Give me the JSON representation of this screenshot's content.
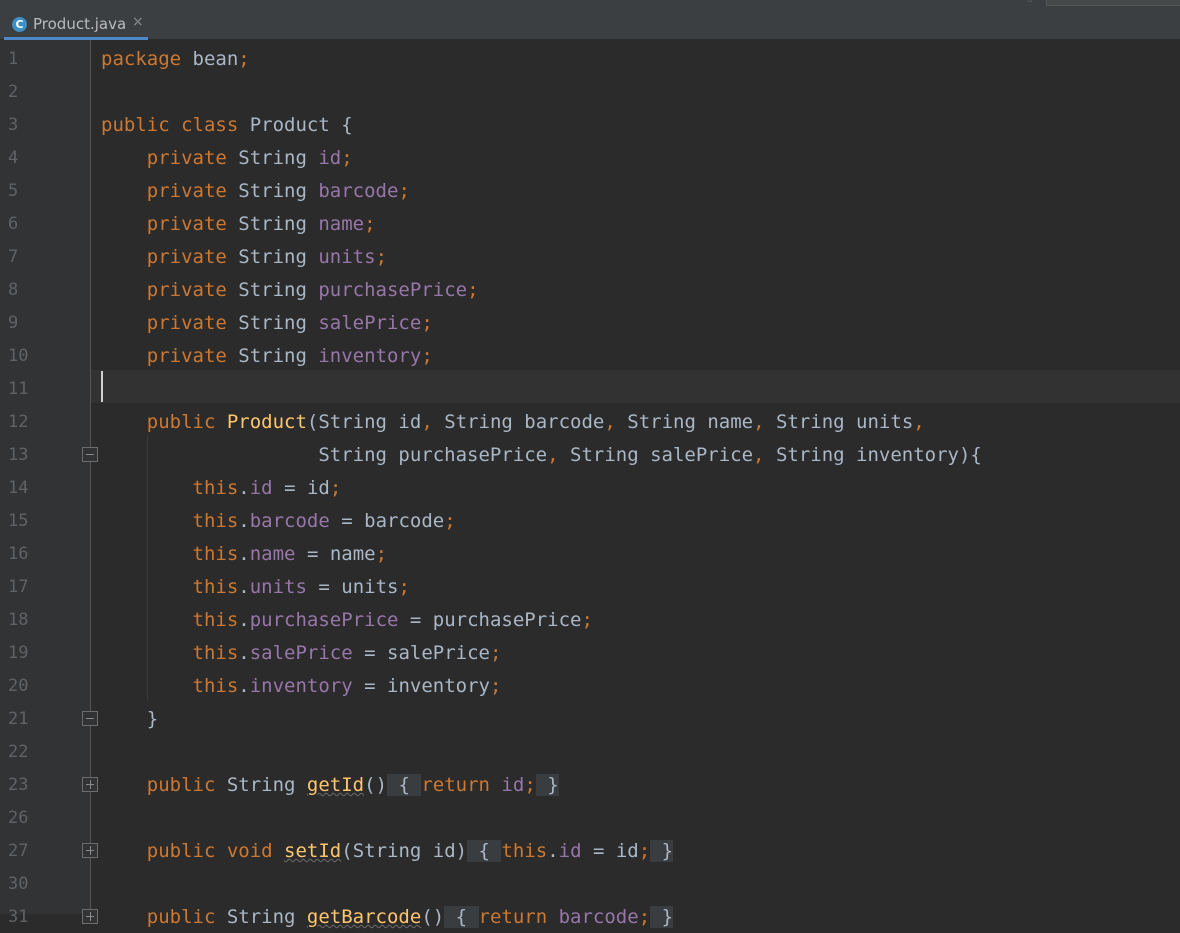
{
  "tab": {
    "label": "Product.java",
    "icon_letter": "C",
    "close": "×"
  },
  "lines": [
    {
      "num": "1",
      "parts": [
        [
          "kw",
          "package "
        ],
        [
          "pl",
          "bean"
        ],
        [
          "punct",
          ";"
        ]
      ]
    },
    {
      "num": "2",
      "parts": []
    },
    {
      "num": "3",
      "parts": [
        [
          "kw",
          "public class "
        ],
        [
          "pl",
          "Product {"
        ]
      ]
    },
    {
      "num": "4",
      "parts": [
        [
          "pl",
          "    "
        ],
        [
          "kw",
          "private "
        ],
        [
          "pl",
          "String "
        ],
        [
          "fld",
          "id"
        ],
        [
          "punct",
          ";"
        ]
      ]
    },
    {
      "num": "5",
      "parts": [
        [
          "pl",
          "    "
        ],
        [
          "kw",
          "private "
        ],
        [
          "pl",
          "String "
        ],
        [
          "fld",
          "barcode"
        ],
        [
          "punct",
          ";"
        ]
      ]
    },
    {
      "num": "6",
      "parts": [
        [
          "pl",
          "    "
        ],
        [
          "kw",
          "private "
        ],
        [
          "pl",
          "String "
        ],
        [
          "fld",
          "name"
        ],
        [
          "punct",
          ";"
        ]
      ]
    },
    {
      "num": "7",
      "parts": [
        [
          "pl",
          "    "
        ],
        [
          "kw",
          "private "
        ],
        [
          "pl",
          "String "
        ],
        [
          "fld",
          "units"
        ],
        [
          "punct",
          ";"
        ]
      ]
    },
    {
      "num": "8",
      "parts": [
        [
          "pl",
          "    "
        ],
        [
          "kw",
          "private "
        ],
        [
          "pl",
          "String "
        ],
        [
          "fld",
          "purchasePrice"
        ],
        [
          "punct",
          ";"
        ]
      ]
    },
    {
      "num": "9",
      "parts": [
        [
          "pl",
          "    "
        ],
        [
          "kw",
          "private "
        ],
        [
          "pl",
          "String "
        ],
        [
          "fld",
          "salePrice"
        ],
        [
          "punct",
          ";"
        ]
      ]
    },
    {
      "num": "10",
      "parts": [
        [
          "pl",
          "    "
        ],
        [
          "kw",
          "private "
        ],
        [
          "pl",
          "String "
        ],
        [
          "fld",
          "inventory"
        ],
        [
          "punct",
          ";"
        ]
      ]
    },
    {
      "num": "11",
      "parts": []
    },
    {
      "num": "12",
      "parts": [
        [
          "pl",
          "    "
        ],
        [
          "kw",
          "public "
        ],
        [
          "fn",
          "Product"
        ],
        [
          "pl",
          "(String id"
        ],
        [
          "punct",
          ", "
        ],
        [
          "pl",
          "String barcode"
        ],
        [
          "punct",
          ", "
        ],
        [
          "pl",
          "String name"
        ],
        [
          "punct",
          ", "
        ],
        [
          "pl",
          "String units"
        ],
        [
          "punct",
          ","
        ]
      ]
    },
    {
      "num": "13",
      "parts": [
        [
          "pl",
          "                   String purchasePrice"
        ],
        [
          "punct",
          ", "
        ],
        [
          "pl",
          "String salePrice"
        ],
        [
          "punct",
          ", "
        ],
        [
          "pl",
          "String inventory){"
        ]
      ]
    },
    {
      "num": "14",
      "parts": [
        [
          "pl",
          "        "
        ],
        [
          "kw",
          "this"
        ],
        [
          "pl",
          "."
        ],
        [
          "fld",
          "id"
        ],
        [
          "pl",
          " = id"
        ],
        [
          "punct",
          ";"
        ]
      ]
    },
    {
      "num": "15",
      "parts": [
        [
          "pl",
          "        "
        ],
        [
          "kw",
          "this"
        ],
        [
          "pl",
          "."
        ],
        [
          "fld",
          "barcode"
        ],
        [
          "pl",
          " = barcode"
        ],
        [
          "punct",
          ";"
        ]
      ]
    },
    {
      "num": "16",
      "parts": [
        [
          "pl",
          "        "
        ],
        [
          "kw",
          "this"
        ],
        [
          "pl",
          "."
        ],
        [
          "fld",
          "name"
        ],
        [
          "pl",
          " = name"
        ],
        [
          "punct",
          ";"
        ]
      ]
    },
    {
      "num": "17",
      "parts": [
        [
          "pl",
          "        "
        ],
        [
          "kw",
          "this"
        ],
        [
          "pl",
          "."
        ],
        [
          "fld",
          "units"
        ],
        [
          "pl",
          " = units"
        ],
        [
          "punct",
          ";"
        ]
      ]
    },
    {
      "num": "18",
      "parts": [
        [
          "pl",
          "        "
        ],
        [
          "kw",
          "this"
        ],
        [
          "pl",
          "."
        ],
        [
          "fld",
          "purchasePrice"
        ],
        [
          "pl",
          " = purchasePrice"
        ],
        [
          "punct",
          ";"
        ]
      ]
    },
    {
      "num": "19",
      "parts": [
        [
          "pl",
          "        "
        ],
        [
          "kw",
          "this"
        ],
        [
          "pl",
          "."
        ],
        [
          "fld",
          "salePrice"
        ],
        [
          "pl",
          " = salePrice"
        ],
        [
          "punct",
          ";"
        ]
      ]
    },
    {
      "num": "20",
      "parts": [
        [
          "pl",
          "        "
        ],
        [
          "kw",
          "this"
        ],
        [
          "pl",
          "."
        ],
        [
          "fld",
          "inventory"
        ],
        [
          "pl",
          " = inventory"
        ],
        [
          "punct",
          ";"
        ]
      ]
    },
    {
      "num": "21",
      "parts": [
        [
          "pl",
          "    }"
        ]
      ]
    },
    {
      "num": "22",
      "parts": []
    },
    {
      "num": "23",
      "parts": [
        [
          "pl",
          "    "
        ],
        [
          "kw",
          "public "
        ],
        [
          "pl",
          "String "
        ],
        [
          "fn-sq",
          "getId"
        ],
        [
          "pl",
          "()"
        ],
        [
          "fold",
          " { "
        ],
        [
          "kw",
          "return "
        ],
        [
          "fld",
          "id"
        ],
        [
          "punct",
          ";"
        ],
        [
          "fold",
          " }"
        ]
      ]
    },
    {
      "num": "26",
      "parts": []
    },
    {
      "num": "27",
      "parts": [
        [
          "pl",
          "    "
        ],
        [
          "kw",
          "public void "
        ],
        [
          "fn-sq",
          "setId"
        ],
        [
          "pl",
          "(String id)"
        ],
        [
          "fold",
          " { "
        ],
        [
          "kw",
          "this"
        ],
        [
          "pl",
          "."
        ],
        [
          "fld",
          "id"
        ],
        [
          "pl",
          " = id"
        ],
        [
          "punct",
          ";"
        ],
        [
          "fold",
          " }"
        ]
      ]
    },
    {
      "num": "30",
      "parts": []
    },
    {
      "num": "31",
      "parts": [
        [
          "pl",
          "    "
        ],
        [
          "kw",
          "public "
        ],
        [
          "pl",
          "String "
        ],
        [
          "fn-sq",
          "getBarcode"
        ],
        [
          "pl",
          "()"
        ],
        [
          "fold",
          " { "
        ],
        [
          "kw",
          "return "
        ],
        [
          "fld",
          "barcode"
        ],
        [
          "punct",
          ";"
        ],
        [
          "fold",
          " }"
        ]
      ]
    }
  ],
  "folds": [
    {
      "line": "13",
      "type": "open"
    },
    {
      "line": "21",
      "type": "open"
    },
    {
      "line": "23",
      "type": "plus"
    },
    {
      "line": "27",
      "type": "plus"
    },
    {
      "line": "31",
      "type": "plus"
    }
  ]
}
